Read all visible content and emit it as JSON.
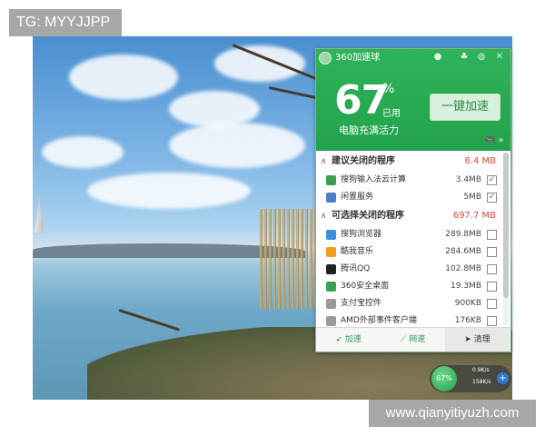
{
  "watermark_top": "TG: MYYJJPP",
  "watermark_bottom": "www.qianyitiyuzh.com",
  "panel": {
    "title": "360加速球",
    "percent": "67",
    "percent_unit": "%",
    "used_label": "已用",
    "vital_label": "电脑充满活力",
    "boost_button": "一键加速",
    "suggest_section": {
      "label": "建议关闭的程序",
      "size": "8.4 MB"
    },
    "suggest_items": [
      {
        "name": "搜狗输入法云计算",
        "size": "3.4MB",
        "checked": "✓",
        "icon": "sogou-cloud-icon",
        "color": "#3aa24e"
      },
      {
        "name": "闲置服务",
        "size": "5MB",
        "checked": "✓",
        "icon": "idle-service-icon",
        "color": "#4a7fc4"
      }
    ],
    "optional_section": {
      "label": "可选择关闭的程序",
      "size": "697.7 MB"
    },
    "optional_items": [
      {
        "name": "搜狗浏览器",
        "size": "289.8MB",
        "checked": "",
        "icon": "sogou-browser-icon",
        "color": "#3c8fd8"
      },
      {
        "name": "酷我音乐",
        "size": "284.6MB",
        "checked": "",
        "icon": "kuwo-music-icon",
        "color": "#f0a020"
      },
      {
        "name": "腾讯QQ",
        "size": "102.8MB",
        "checked": "",
        "icon": "qq-penguin-icon",
        "color": "#222222"
      },
      {
        "name": "360安全桌面",
        "size": "19.3MB",
        "checked": "",
        "icon": "360-desktop-icon",
        "color": "#3aa24e"
      },
      {
        "name": "支付宝控件",
        "size": "900KB",
        "checked": "",
        "icon": "alipay-control-icon",
        "color": "#9a9a9a"
      },
      {
        "name": "AMD外部事件客户端",
        "size": "176KB",
        "checked": "",
        "icon": "amd-client-icon",
        "color": "#9a9a9a"
      }
    ],
    "tabs": [
      {
        "label": "加速",
        "icon": "rocket-icon"
      },
      {
        "label": "网速",
        "icon": "network-speed-icon"
      },
      {
        "label": "清理",
        "icon": "broom-icon"
      }
    ]
  },
  "float_ball": {
    "percent": "67%",
    "up": "0.9K/s",
    "down": "158K/s"
  },
  "colors": {
    "accent": "#22a24c",
    "danger": "#e0463c"
  }
}
